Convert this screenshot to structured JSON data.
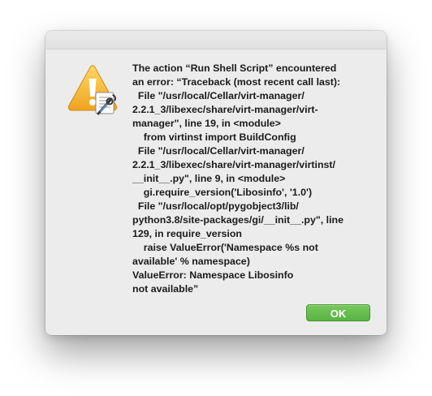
{
  "dialog": {
    "icon": "warning-triangle-icon",
    "badge_icon": "script-editor-icon",
    "message": "The action “Run Shell Script” encountered\nan error: “Traceback (most recent call last):\n  File \"/usr/local/Cellar/virt-manager/\n2.2.1_3/libexec/share/virt-manager/virt-\nmanager\", line 19, in <module>\n    from virtinst import BuildConfig\n  File \"/usr/local/Cellar/virt-manager/\n2.2.1_3/libexec/share/virt-manager/virtinst/\n__init__.py\", line 9, in <module>\n    gi.require_version('Libosinfo', '1.0')\n  File \"/usr/local/opt/pygobject3/lib/\npython3.8/site-packages/gi/__init__.py\", line\n129, in require_version\n    raise ValueError('Namespace %s not\navailable' % namespace)\nValueError: Namespace Libosinfo\nnot available”",
    "ok_label": "OK"
  },
  "colors": {
    "window_bg": "#ececec",
    "button_green": "#5fb84a",
    "warning_yellow": "#f2b632"
  }
}
